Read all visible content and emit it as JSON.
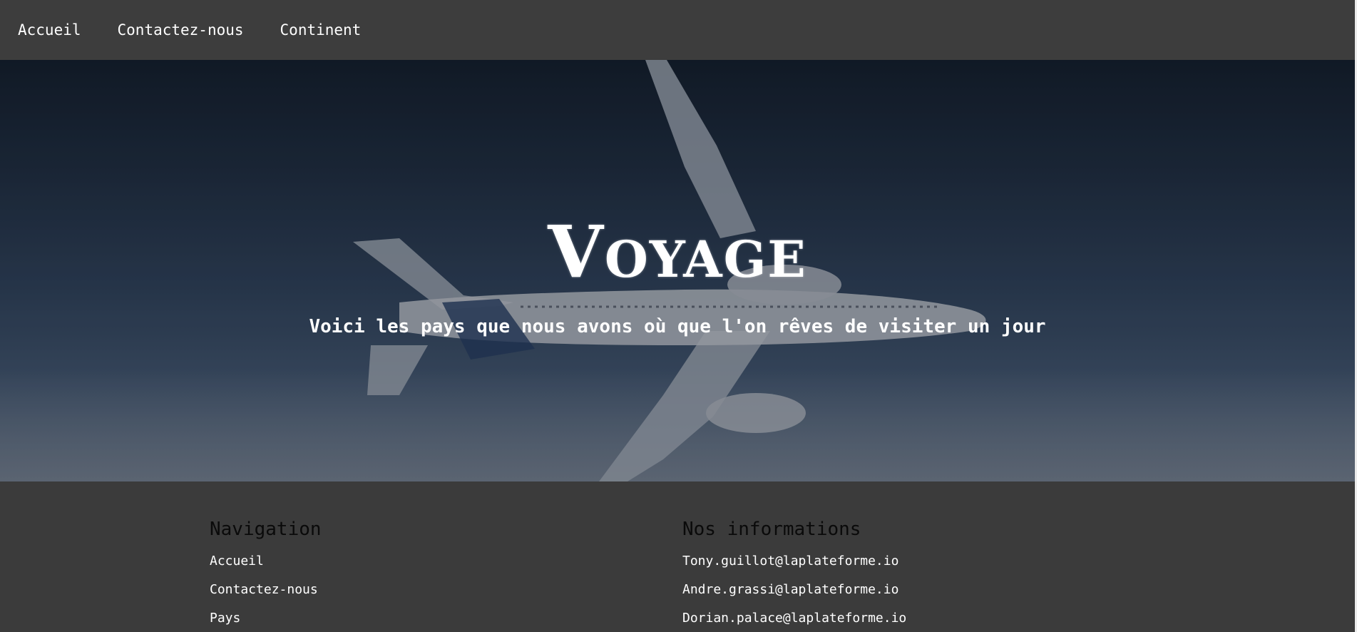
{
  "nav": {
    "items": [
      {
        "label": "Accueil"
      },
      {
        "label": "Contactez-nous"
      },
      {
        "label": "Continent"
      }
    ]
  },
  "hero": {
    "title": "Voyage",
    "subtitle": "Voici les pays que nous avons où que l'on rêves de visiter un jour"
  },
  "footer": {
    "navigation": {
      "heading": "Navigation",
      "links": [
        {
          "label": "Accueil"
        },
        {
          "label": "Contactez-nous"
        },
        {
          "label": "Pays"
        }
      ]
    },
    "informations": {
      "heading": "Nos informations",
      "emails": [
        {
          "label": "Tony.guillot@laplateforme.io"
        },
        {
          "label": "Andre.grassi@laplateforme.io"
        },
        {
          "label": "Dorian.palace@laplateforme.io"
        }
      ]
    }
  },
  "colors": {
    "header_bg": "#3d3d3d",
    "footer_bg": "#3b3b3b",
    "footer_heading": "#0a0a0a",
    "text": "#ffffff"
  }
}
